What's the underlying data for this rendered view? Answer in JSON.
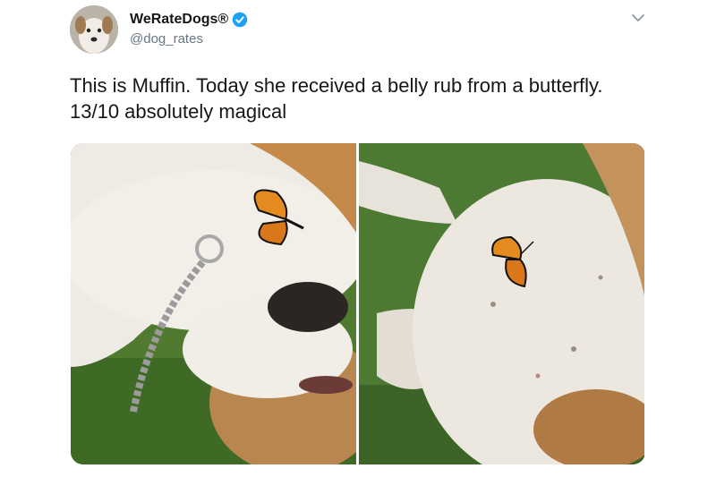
{
  "tweet": {
    "author": {
      "display_name": "WeRateDogs®",
      "handle": "@dog_rates",
      "avatar_icon": "dog-avatar-icon",
      "verified_icon": "verified-badge-icon"
    },
    "text": "This is Muffin. Today she received a belly rub from a butterfly. 13/10 absolutely magical",
    "menu_icon": "chevron-down-icon",
    "media": [
      {
        "description_icon": "dog-with-butterfly-photo-1"
      },
      {
        "description_icon": "dog-belly-with-butterfly-photo-2"
      }
    ]
  },
  "colors": {
    "verified_blue": "#1da1f2",
    "handle_gray": "#657786",
    "text_dark": "#14171a"
  }
}
